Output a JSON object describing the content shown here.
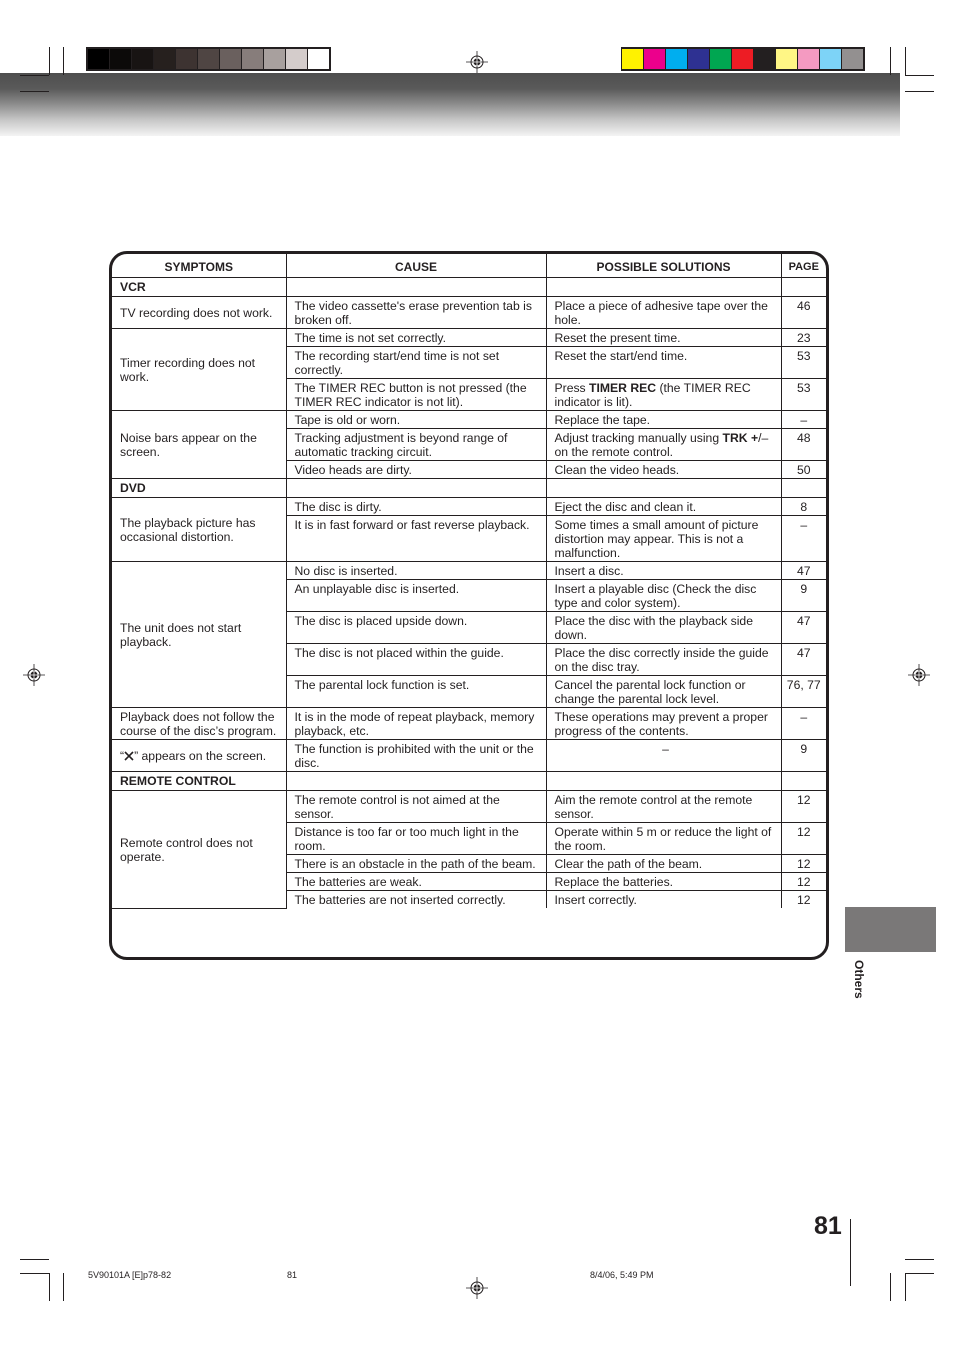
{
  "print_marks": {
    "grayscale_swatches": [
      "#000000",
      "#0c0a09",
      "#181413",
      "#26201e",
      "#3d3331",
      "#4f4543",
      "#6a605e",
      "#877d7b",
      "#a8a09e",
      "#d4cccb",
      "#ffffff"
    ],
    "color_swatches": [
      "#fff200",
      "#ec008c",
      "#00aeef",
      "#2e3192",
      "#00a651",
      "#ed1c24",
      "#231f20",
      "#fff685",
      "#f49ac1",
      "#7dd3f7",
      "#939090"
    ]
  },
  "table": {
    "headers": {
      "symptoms": "SYMPTOMS",
      "cause": "CAUSE",
      "solutions": "POSSIBLE SOLUTIONS",
      "page": "PAGE"
    },
    "sections": [
      {
        "title": "VCR",
        "groups": [
          {
            "symptom": "TV recording does not work.",
            "rows": [
              {
                "cause": "The video cassette's erase prevention tab is broken off.",
                "solution": "Place a piece of adhesive tape over the hole.",
                "page": "46"
              }
            ]
          },
          {
            "symptom": "Timer recording does not work.",
            "rows": [
              {
                "cause": "The time is not set correctly.",
                "solution": "Reset the present time.",
                "page": "23"
              },
              {
                "cause": "The recording start/end time is not set correctly.",
                "solution": "Reset the start/end time.",
                "page": "53"
              },
              {
                "cause": "The TIMER REC button is not pressed (the TIMER REC indicator is not lit).",
                "solution_prefix": "Press ",
                "solution_bold": "TIMER REC",
                "solution_suffix": " (the TIMER REC indicator is lit).",
                "page": "53"
              }
            ]
          },
          {
            "symptom": "Noise bars appear on the screen.",
            "rows": [
              {
                "cause": "Tape is old or worn.",
                "solution": "Replace the tape.",
                "page": "–"
              },
              {
                "cause": "Tracking adjustment is beyond range of automatic tracking circuit.",
                "solution_prefix": "Adjust tracking manually using ",
                "solution_bold": "TRK +",
                "solution_suffix": "/– on the remote control.",
                "page": "48"
              },
              {
                "cause": "Video heads are dirty.",
                "solution": "Clean the video heads.",
                "page": "50"
              }
            ]
          }
        ]
      },
      {
        "title": "DVD",
        "groups": [
          {
            "symptom": "The playback picture has occasional distortion.",
            "rows": [
              {
                "cause": "The disc is dirty.",
                "solution": "Eject the disc and clean it.",
                "page": "8"
              },
              {
                "cause": "It is in fast forward or fast reverse playback.",
                "solution": "Some times a small amount of picture distortion may appear. This is not a malfunction.",
                "page": "–"
              }
            ]
          },
          {
            "symptom": "The unit does not start playback.",
            "rows": [
              {
                "cause": "No disc is inserted.",
                "solution": "Insert a disc.",
                "page": "47"
              },
              {
                "cause": "An unplayable disc is inserted.",
                "solution": "Insert a playable disc (Check the disc type and color system).",
                "page": "9"
              },
              {
                "cause": "The disc is placed upside down.",
                "solution": "Place the disc with the playback side down.",
                "page": "47"
              },
              {
                "cause": "The disc is not placed within the guide.",
                "solution": "Place the disc correctly inside the guide on the disc tray.",
                "page": "47"
              },
              {
                "cause": "The parental lock function is set.",
                "solution": "Cancel the parental lock function or change the parental lock level.",
                "page": "76, 77"
              }
            ]
          },
          {
            "symptom": "Playback does not follow the course of the disc’s program.",
            "rows": [
              {
                "cause": "It is in the mode of repeat playback, memory playback, etc.",
                "solution": "These operations may prevent a proper progress of the contents.",
                "page": "–"
              }
            ]
          },
          {
            "symptom_prefix": "“",
            "symptom_icon": "prohibited-x-icon",
            "symptom_suffix": "” appears on the screen.",
            "rows": [
              {
                "cause": "The function is prohibited with the unit or the disc.",
                "solution": "–",
                "page": "9"
              }
            ]
          }
        ]
      },
      {
        "title": "REMOTE CONTROL",
        "groups": [
          {
            "symptom": "Remote control does not operate.",
            "rows": [
              {
                "cause": "The remote control is not aimed at the sensor.",
                "solution": "Aim the remote control at the remote sensor.",
                "page": "12"
              },
              {
                "cause": "Distance is too far or too much light in the room.",
                "solution": "Operate within 5 m or reduce  the light of the room.",
                "page": "12"
              },
              {
                "cause": "There is an obstacle in the path of the beam.",
                "solution": "Clear the path of the beam.",
                "page": "12"
              },
              {
                "cause": "The batteries are weak.",
                "solution": "Replace the batteries.",
                "page": "12"
              },
              {
                "cause": "The batteries are not inserted correctly.",
                "solution": "Insert correctly.",
                "page": "12"
              }
            ]
          }
        ]
      }
    ]
  },
  "side_tab": {
    "label": "Others",
    "color": "#7a7878"
  },
  "page_number": "81",
  "footer": {
    "file": "5V90101A [E]p78-82",
    "page": "81",
    "timestamp": "8/4/06, 5:49 PM"
  }
}
